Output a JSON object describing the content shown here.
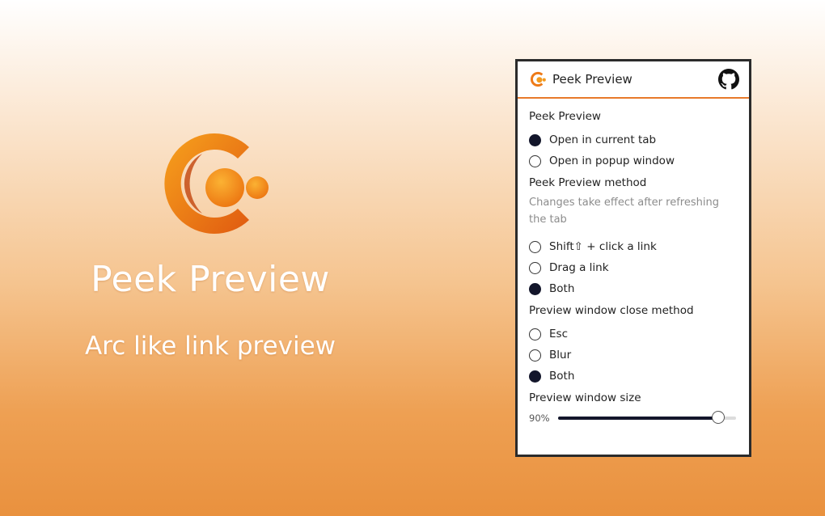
{
  "hero": {
    "title": "Peek Preview",
    "subtitle": "Arc like link preview",
    "logo_icon": "peek-preview-logo"
  },
  "popup": {
    "header": {
      "title": "Peek Preview",
      "github_icon": "github-icon"
    },
    "sections": [
      {
        "title": "Peek Preview",
        "hint": "",
        "options": [
          {
            "label": "Open in current tab",
            "selected": true
          },
          {
            "label": "Open in popup window",
            "selected": false
          }
        ]
      },
      {
        "title": "Peek Preview method",
        "hint": "Changes take effect after refreshing the tab",
        "options": [
          {
            "label": "Shift⇧ + click a link",
            "selected": false
          },
          {
            "label": "Drag a link",
            "selected": false
          },
          {
            "label": "Both",
            "selected": true
          }
        ]
      },
      {
        "title": "Preview window close method",
        "hint": "",
        "options": [
          {
            "label": "Esc",
            "selected": false
          },
          {
            "label": "Blur",
            "selected": false
          },
          {
            "label": "Both",
            "selected": true
          }
        ]
      }
    ],
    "size": {
      "title": "Preview window size",
      "value_label": "90%",
      "value": 0.9
    }
  },
  "colors": {
    "accent": "#e8792a",
    "radio_selected": "#13162b",
    "hint_text": "#8c8c8c"
  }
}
